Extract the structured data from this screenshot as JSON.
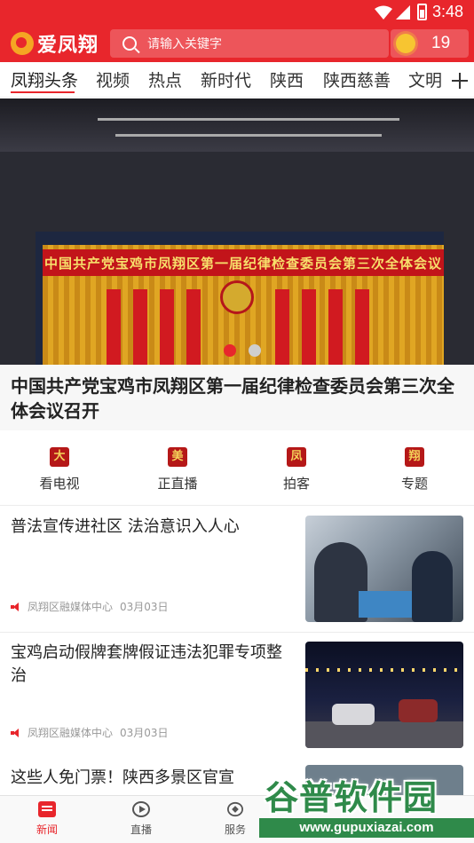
{
  "status_bar": {
    "time": "3:48"
  },
  "header": {
    "logo_text": "爱凤翔",
    "search_placeholder": "请输入关键字",
    "weather_temp": "19",
    "weather_icon": "sunny-icon"
  },
  "tabs": [
    {
      "label": "凤翔头条",
      "active": true
    },
    {
      "label": "视频"
    },
    {
      "label": "热点"
    },
    {
      "label": "新时代"
    },
    {
      "label": "陕西"
    },
    {
      "label": "陕西慈善"
    },
    {
      "label": "文明"
    }
  ],
  "banner": {
    "stage_headline": "中国共产党宝鸡市凤翔区第一届纪律检查委员会第三次全体会议",
    "caption": "中国共产党宝鸡市凤翔区第一届纪律检查委员会第三次全体会议召开",
    "slide_count": 2,
    "active_slide": 1
  },
  "quick_links": [
    {
      "icon_char": "大",
      "label": "看电视",
      "icon": "tv-icon"
    },
    {
      "icon_char": "美",
      "label": "正直播",
      "icon": "live-icon"
    },
    {
      "icon_char": "凤",
      "label": "拍客",
      "icon": "camera-icon"
    },
    {
      "icon_char": "翔",
      "label": "专题",
      "icon": "topic-icon"
    }
  ],
  "news": [
    {
      "title": "普法宣传进社区 法治意识入人心",
      "source": "凤翔区融媒体中心",
      "date": "03月03日"
    },
    {
      "title": "宝鸡启动假牌套牌假证违法犯罪专项整治",
      "source": "凤翔区融媒体中心",
      "date": "03月03日"
    },
    {
      "title": "这些人免门票！陕西多景区官宣"
    }
  ],
  "bottom_nav": [
    {
      "label": "新闻",
      "active": true
    },
    {
      "label": "直播"
    },
    {
      "label": "服务"
    }
  ],
  "watermark": {
    "brand": "谷普软件园",
    "url": "www.gupuxiazai.com"
  },
  "colors": {
    "brand_red": "#e8262c",
    "watermark_green": "#2f8a4a"
  }
}
